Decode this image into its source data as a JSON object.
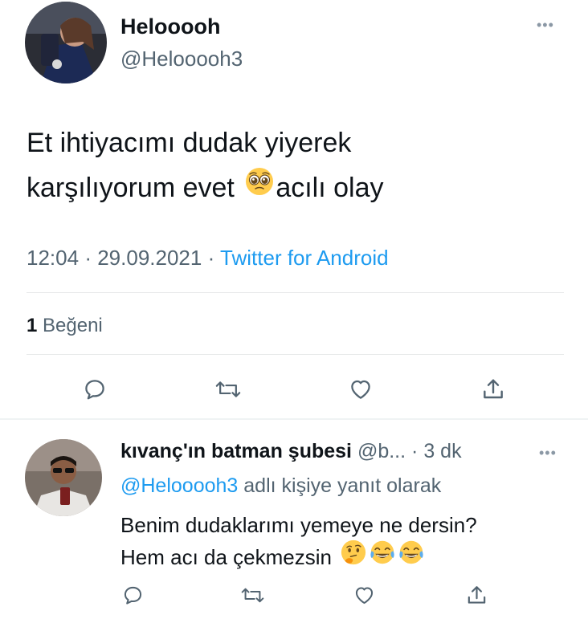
{
  "main_tweet": {
    "display_name": "Helooooh",
    "handle": "@Helooooh3",
    "text_line1": "Et ihtiyacımı dudak yiyerek",
    "text_line2_a": "karşılıyorum evet",
    "text_line2_b": "acılı olay",
    "emoji_inline": "pleading-face",
    "time": "12:04",
    "date": "29.09.2021",
    "separator": "·",
    "source": "Twitter for Android",
    "likes_count": "1",
    "likes_label": "Beğeni"
  },
  "reply": {
    "display_name": "kıvanç'ın batman şubesi",
    "handle": "@b...",
    "separator": "·",
    "time": "3 dk",
    "replying_mention": "@Helooooh3",
    "replying_suffix": "adlı kişiye yanıt olarak",
    "text_line1": "Benim dudaklarımı yemeye ne dersin?",
    "text_line2": "Hem acı da çekmezsin",
    "emojis": [
      "thinking-face",
      "face-with-tears-of-joy",
      "face-with-tears-of-joy"
    ]
  },
  "actions": [
    "reply",
    "retweet",
    "like",
    "share"
  ],
  "colors": {
    "text": "#0f1419",
    "secondary": "#536471",
    "accent": "#1d9bf0",
    "icon": "#536471",
    "divider": "#e7e9ea"
  }
}
